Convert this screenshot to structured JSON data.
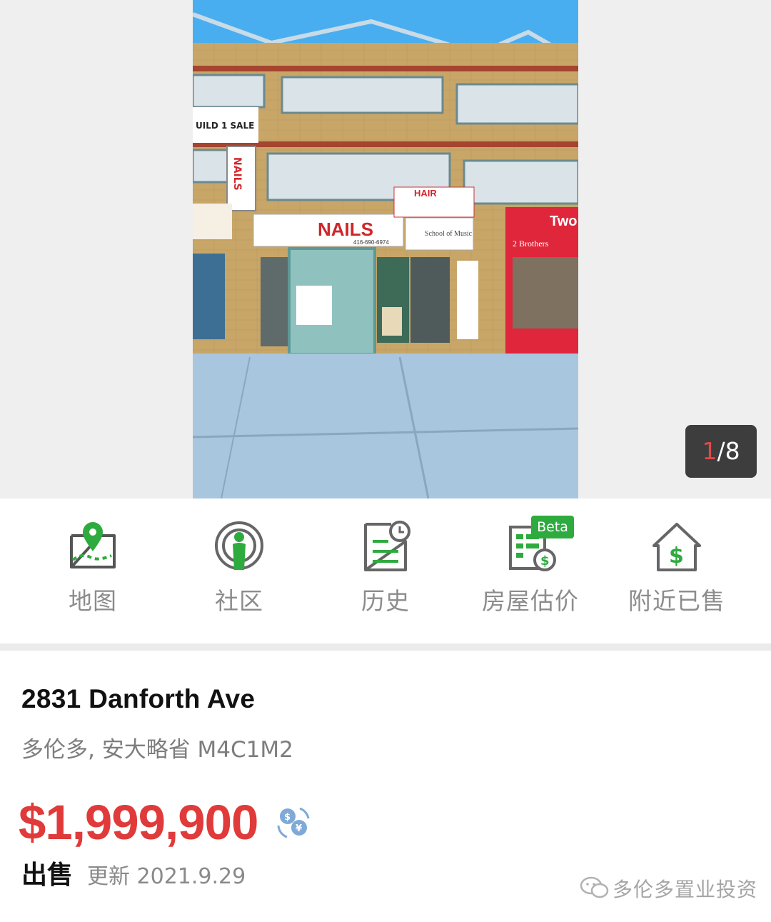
{
  "gallery": {
    "photo_alt": "2831 Danforth Ave",
    "counter_current": "1",
    "counter_separator": "/",
    "counter_total": "8",
    "storefront_signs": {
      "nails": "NAILS",
      "nails_phone": "416-690-6974",
      "hair": "HAIR",
      "music": "School of Music",
      "two_brothers": "2 Brothers",
      "two": "Two",
      "build_sale": "UILD 1 SALE"
    }
  },
  "actions": [
    {
      "label": "地图",
      "icon": "map-pin-icon"
    },
    {
      "label": "社区",
      "icon": "community-icon"
    },
    {
      "label": "历史",
      "icon": "history-icon"
    },
    {
      "label": "房屋估价",
      "icon": "valuation-icon",
      "badge": "Beta"
    },
    {
      "label": "附近已售",
      "icon": "nearby-sold-icon"
    }
  ],
  "listing": {
    "address": "2831 Danforth Ave",
    "city_line": "多伦多, 安大略省 M4C1M2",
    "price": "$1,999,900",
    "status": "出售",
    "updated": "更新 2021.9.29"
  },
  "watermark": {
    "text": "多伦多置业投资",
    "icon": "wechat-icon"
  },
  "colors": {
    "accent_green": "#2eab3e",
    "price_red": "#e03a3a",
    "counter_bg": "#3d3d3d"
  }
}
